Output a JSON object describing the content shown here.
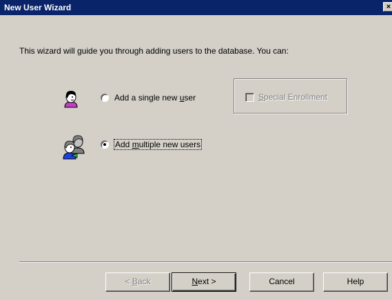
{
  "window": {
    "title": "New User Wizard",
    "close_glyph": "×"
  },
  "intro_text": "This wizard will guide you through adding users to the database. You can:",
  "options": {
    "single": {
      "label_before": "Add a single new ",
      "label_accel": "u",
      "label_after": "ser",
      "selected": false,
      "icon": "single-user-icon"
    },
    "multiple": {
      "label_before": "Add ",
      "label_accel": "m",
      "label_after": "ultiple new users",
      "selected": true,
      "icon": "multiple-users-icon"
    }
  },
  "special_enrollment": {
    "label_accel": "S",
    "label_after": "pecial Enrollment",
    "checked": false,
    "enabled": false
  },
  "buttons": {
    "back": {
      "prefix": "< ",
      "accel": "B",
      "rest": "ack",
      "enabled": false
    },
    "next": {
      "accel": "N",
      "rest": "ext >",
      "enabled": true
    },
    "cancel": {
      "label": "Cancel",
      "enabled": true
    },
    "help": {
      "label": "Help",
      "enabled": true
    }
  },
  "colors": {
    "titlebar": "#0a246a",
    "face": "#d4d0c8",
    "disabled_text": "#808080"
  }
}
